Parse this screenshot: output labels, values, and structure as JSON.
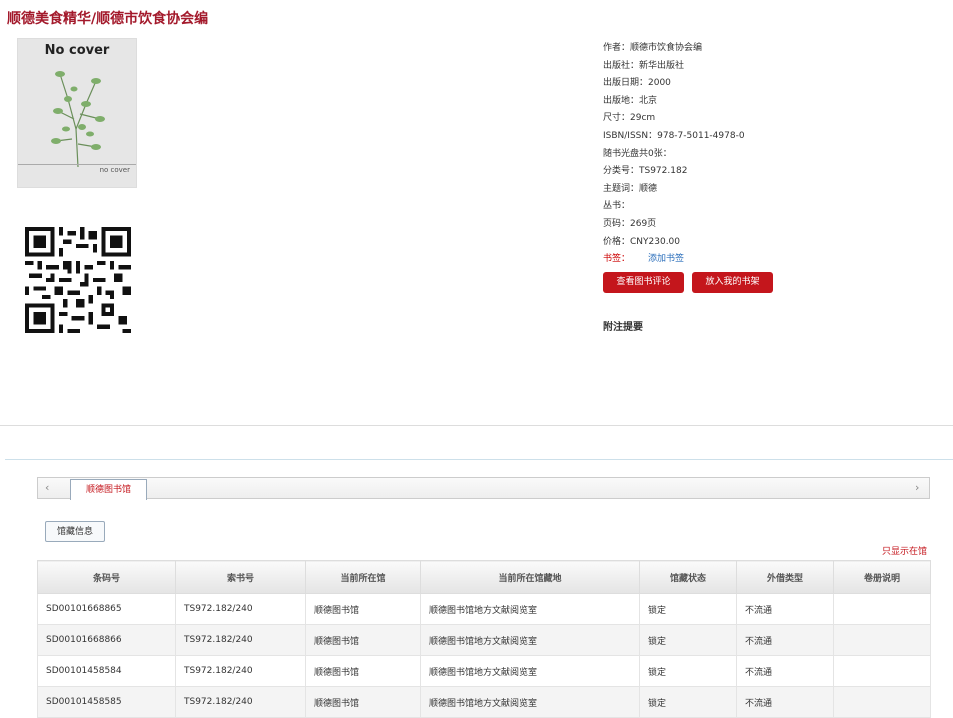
{
  "title": "顺德美食精华/顺德市饮食协会编",
  "cover": {
    "label": "No cover",
    "small_label": "no cover"
  },
  "meta": {
    "author": "作者：顺德市饮食协会编",
    "publisher": "出版社：新华出版社",
    "pub_date": "出版日期：2000",
    "pub_place": "出版地：北京",
    "size": "尺寸：29cm",
    "isbn": "ISBN/ISSN：978-7-5011-4978-0",
    "cd": "随书光盘共0张：",
    "class_no": "分类号：TS972.182",
    "subject": "主题词：顺德",
    "series": "丛书：",
    "pages": "页码：269页",
    "price": "价格：CNY230.00",
    "bookmark_label": "书签：",
    "bookmark_link": "添加书签"
  },
  "buttons": {
    "review": "查看图书评论",
    "shelf": "放入我的书架"
  },
  "notes_label": "附注提要",
  "holdings": {
    "library_tab": "顺德图书馆",
    "sub_tab": "馆藏信息",
    "toggle": "只显示在馆",
    "columns": [
      "条码号",
      "索书号",
      "当前所在馆",
      "当前所在馆藏地",
      "馆藏状态",
      "外借类型",
      "卷册说明"
    ],
    "rows": [
      [
        "SD00101668865",
        "TS972.182/240",
        "顺德图书馆",
        "顺德图书馆地方文献阅览室",
        "锁定",
        "不流通",
        ""
      ],
      [
        "SD00101668866",
        "TS972.182/240",
        "顺德图书馆",
        "顺德图书馆地方文献阅览室",
        "锁定",
        "不流通",
        ""
      ],
      [
        "SD00101458584",
        "TS972.182/240",
        "顺德图书馆",
        "顺德图书馆地方文献阅览室",
        "锁定",
        "不流通",
        ""
      ],
      [
        "SD00101458585",
        "TS972.182/240",
        "顺德图书馆",
        "顺德图书馆地方文献阅览室",
        "锁定",
        "不流通",
        ""
      ]
    ]
  }
}
